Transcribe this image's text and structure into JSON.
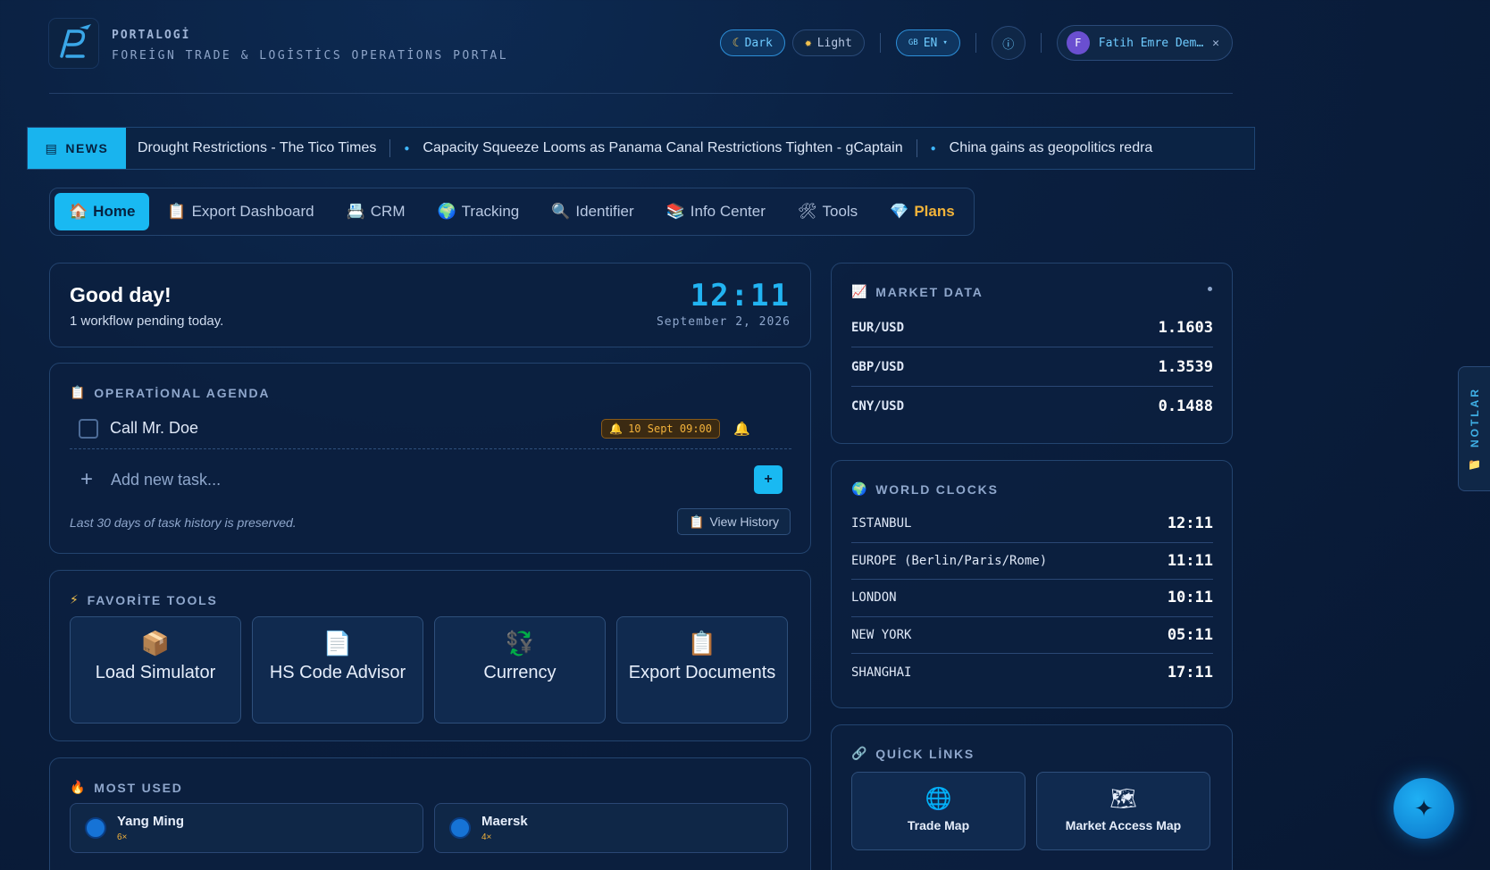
{
  "brand": {
    "name": "PORTALOGİ",
    "subtitle": "FOREİGN TRADE & LOGİSTİCS OPERATİONS PORTAL"
  },
  "header": {
    "theme_dark": "Dark",
    "theme_light": "Light",
    "language": "EN",
    "language_flag": "GB",
    "info_icon": "info-icon",
    "user_initial": "F",
    "user_name": "Fatih Emre Dem…"
  },
  "news": {
    "label": "NEWS",
    "items": [
      "Drought Restrictions - The Tico Times",
      "Capacity Squeeze Looms as Panama Canal Restrictions Tighten - gCaptain",
      "China gains as geopolitics redra"
    ]
  },
  "tabs": [
    {
      "label": "Home",
      "icon": "🏠"
    },
    {
      "label": "Export Dashboard",
      "icon": "📋"
    },
    {
      "label": "CRM",
      "icon": "📇"
    },
    {
      "label": "Tracking",
      "icon": "🌍"
    },
    {
      "label": "Identifier",
      "icon": "🔍"
    },
    {
      "label": "Info Center",
      "icon": "📚"
    },
    {
      "label": "Tools",
      "icon": "🛠"
    },
    {
      "label": "Plans",
      "icon": "💎"
    }
  ],
  "greeting": {
    "title": "Good day!",
    "subtitle": "1 workflow pending today.",
    "time": "12:11",
    "date": "September 2, 2026"
  },
  "agenda": {
    "title": "OPERATİONAL AGENDA",
    "tasks": [
      {
        "label": "Call Mr. Doe",
        "reminder": "10 Sept 09:00"
      }
    ],
    "add_placeholder": "Add new task...",
    "add_button": "+",
    "history_note": "Last 30 days of task history is preserved.",
    "history_button": "View History"
  },
  "favorites": {
    "title": "FAVORİTE TOOLS",
    "items": [
      {
        "label": "Load Simulator",
        "icon": "📦"
      },
      {
        "label": "HS Code Advisor",
        "icon": "📄"
      },
      {
        "label": "Currency",
        "icon": "💱"
      },
      {
        "label": "Export Documents",
        "icon": "📋"
      }
    ]
  },
  "most_used": {
    "title": "MOST USED",
    "items": [
      {
        "name": "Yang Ming",
        "count": "6×"
      },
      {
        "name": "Maersk",
        "count": "4×"
      }
    ]
  },
  "market": {
    "title": "MARKET DATA",
    "rows": [
      {
        "pair": "EUR/USD",
        "value": "1.1603"
      },
      {
        "pair": "GBP/USD",
        "value": "1.3539"
      },
      {
        "pair": "CNY/USD",
        "value": "0.1488"
      }
    ]
  },
  "world_clocks": {
    "title": "WORLD CLOCKS",
    "rows": [
      {
        "city": "ISTANBUL",
        "time": "12:11"
      },
      {
        "city": "EUROPE (Berlin/Paris/Rome)",
        "time": "11:11"
      },
      {
        "city": "LONDON",
        "time": "10:11"
      },
      {
        "city": "NEW YORK",
        "time": "05:11"
      },
      {
        "city": "SHANGHAI",
        "time": "17:11"
      }
    ]
  },
  "quick_links": {
    "title": "QUİCK LİNKS",
    "items": [
      {
        "label": "Trade Map",
        "icon": "🌐"
      },
      {
        "label": "Market Access Map",
        "icon": "🗺"
      }
    ]
  },
  "notes_tab": {
    "label": "NOTLAR"
  },
  "colors": {
    "accent": "#19b9f2",
    "background": "#0a1f3f",
    "warning": "#f2b23b"
  }
}
